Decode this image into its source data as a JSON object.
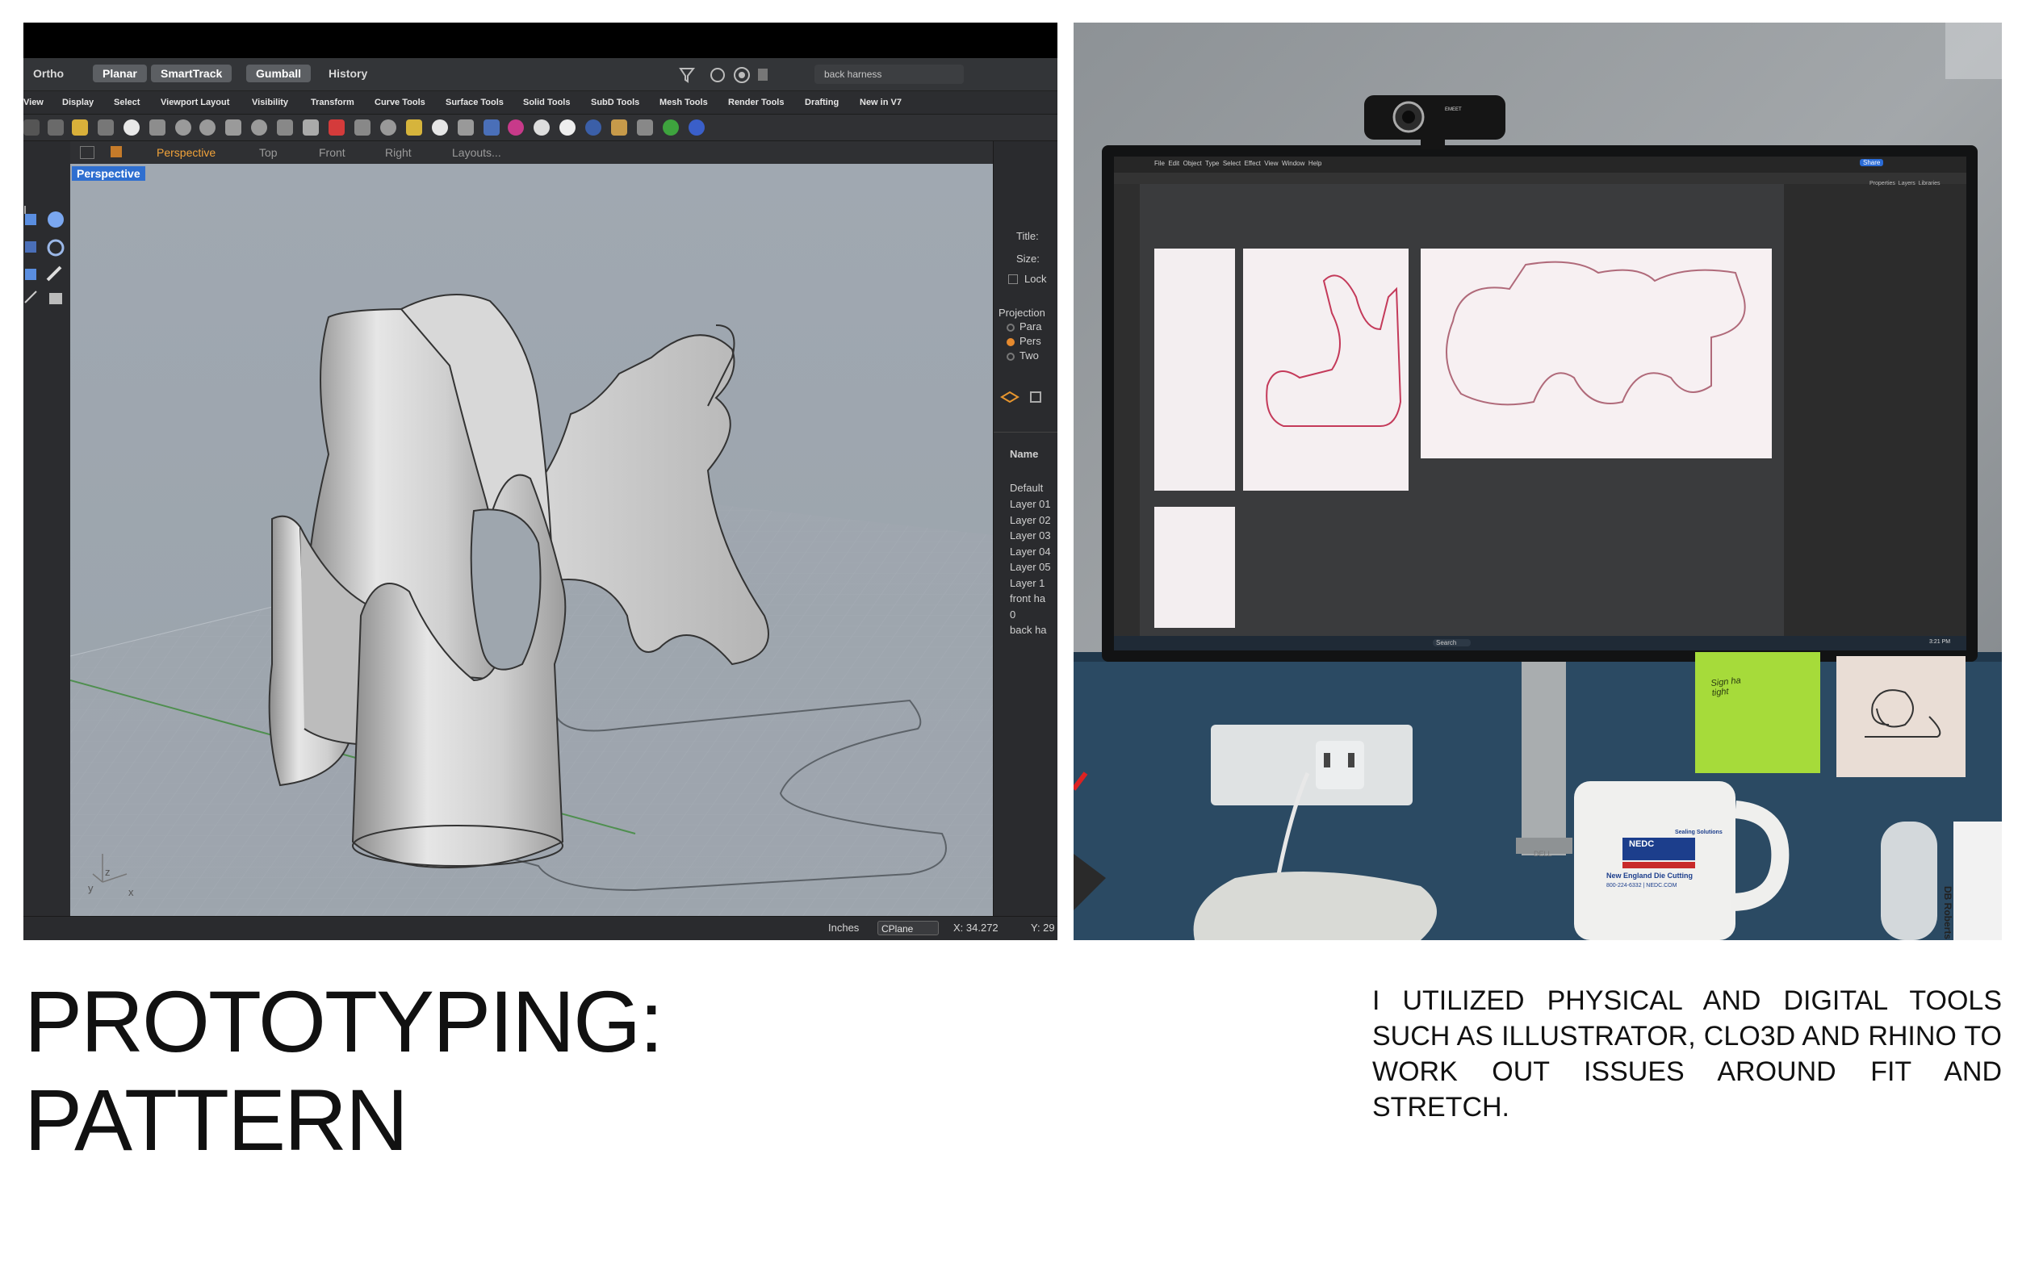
{
  "rhino": {
    "status_buttons": [
      {
        "label": "Ortho",
        "active": false
      },
      {
        "label": "Planar",
        "active": true
      },
      {
        "label": "SmartTrack",
        "active": true
      },
      {
        "label": "Gumball",
        "active": true
      },
      {
        "label": "History",
        "active": false
      }
    ],
    "search_placeholder": "back harness",
    "tabs": [
      "View",
      "Display",
      "Select",
      "Viewport Layout",
      "Visibility",
      "Transform",
      "Curve Tools",
      "Surface Tools",
      "Solid Tools",
      "SubD Tools",
      "Mesh Tools",
      "Render Tools",
      "Drafting",
      "New in V7"
    ],
    "viewport_tabs": [
      "Perspective",
      "Top",
      "Front",
      "Right",
      "Layouts..."
    ],
    "viewport_label": "Perspective",
    "panel": {
      "title_label": "Title:",
      "size_label": "Size:",
      "locked_label": "Lock",
      "projection_label": "Projection",
      "projection_options": [
        "Para",
        "Pers",
        "Two"
      ],
      "name_header": "Name",
      "layers": [
        "Default",
        "Layer 01",
        "Layer 02",
        "Layer 03",
        "Layer 04",
        "Layer 05",
        "Layer 1",
        "front ha",
        "0",
        "back ha"
      ]
    },
    "axes": {
      "z": "z",
      "y": "y",
      "x": "x"
    },
    "bottom": {
      "units": "Inches",
      "cplane": "CPlane",
      "x": "X: 34.272",
      "y": "Y: 29"
    }
  },
  "photo": {
    "webcam_brand": "EMEET",
    "menu": [
      "File",
      "Edit",
      "Object",
      "Type",
      "Select",
      "Effect",
      "View",
      "Window",
      "Help"
    ],
    "share": "Share",
    "panel_tabs": [
      "Properties",
      "Layers",
      "Libraries"
    ],
    "search": "Search",
    "time": "3:21 PM",
    "sticky_note": "Sign ha tight",
    "mug_logo": "NEDC",
    "mug_lines": [
      "Sealing Solutions",
      "New England Die Cutting",
      "800-224-6332 | NEDC.COM"
    ],
    "monitor_brand": "DELL",
    "side_label": "DB Roberts"
  },
  "title_lines": [
    "PROTOTYPING:",
    "PATTERN"
  ],
  "description": "I UTILIZED PHYSICAL AND DIGITAL TOOLS SUCH AS ILLUSTRATOR, CLO3D AND RHINO TO WORK OUT ISSUES AROUND FIT AND STRETCH."
}
